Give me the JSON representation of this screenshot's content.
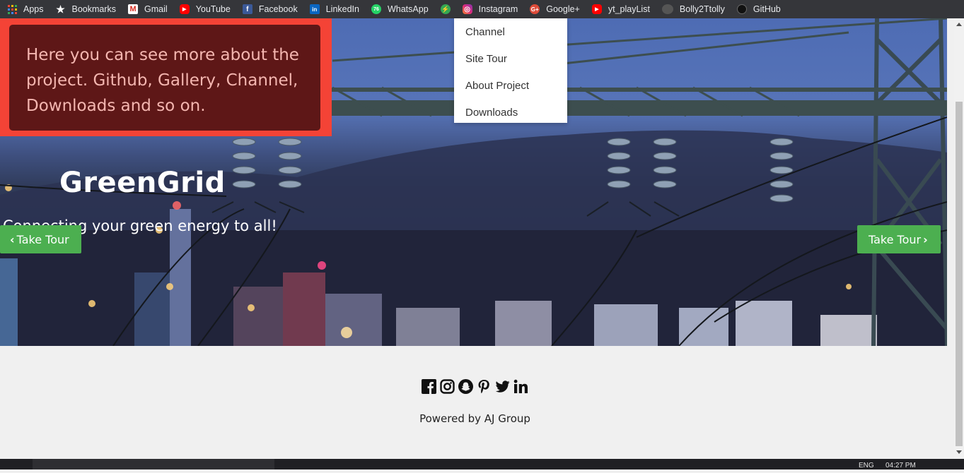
{
  "bookmarks": [
    {
      "label": "Apps",
      "icon": "apps-grid-icon",
      "color": "#4285f4"
    },
    {
      "label": "Bookmarks",
      "icon": "star-icon",
      "color": "#ffffff"
    },
    {
      "label": "Gmail",
      "icon": "gmail-icon",
      "color": "#d93025"
    },
    {
      "label": "YouTube",
      "icon": "youtube-icon",
      "color": "#ff0000"
    },
    {
      "label": "Facebook",
      "icon": "facebook-icon",
      "color": "#3b5998"
    },
    {
      "label": "LinkedIn",
      "icon": "linkedin-icon",
      "color": "#0a66c2"
    },
    {
      "label": "WhatsApp",
      "icon": "whatsapp-icon",
      "color": "#25d366"
    },
    {
      "label": "",
      "icon": "bolt-icon",
      "color": "#34a853"
    },
    {
      "label": "Instagram",
      "icon": "instagram-icon",
      "color": "#e1306c"
    },
    {
      "label": "Google+",
      "icon": "google-plus-icon",
      "color": "#dd4b39"
    },
    {
      "label": "yt_playList",
      "icon": "youtube-icon",
      "color": "#ff0000"
    },
    {
      "label": "Bolly2Ttolly",
      "icon": "bolly-icon",
      "color": "#444444"
    },
    {
      "label": "GitHub",
      "icon": "github-icon",
      "color": "#222222"
    }
  ],
  "tour": {
    "message": "Here you can see more about the project. Github, Gallery, Channel, Downloads and so on."
  },
  "hero": {
    "brand": "GreenGrid",
    "tagline": "Connecting your green energy to all!"
  },
  "buttons": {
    "prev": "Take Tour",
    "next": "Take Tour"
  },
  "dropdown": {
    "items": [
      "Channel",
      "Site Tour",
      "About Project",
      "Downloads"
    ]
  },
  "footer": {
    "social": [
      "facebook-icon",
      "instagram-icon",
      "snapchat-icon",
      "pinterest-icon",
      "twitter-icon",
      "linkedin-icon"
    ],
    "powered": "Powered by AJ Group"
  },
  "taskbar": {
    "lang": "ENG",
    "time": "04:27 PM"
  },
  "colors": {
    "callout_border": "#f44336",
    "callout_bg": "#5e1717",
    "button_green": "#4caf50"
  }
}
